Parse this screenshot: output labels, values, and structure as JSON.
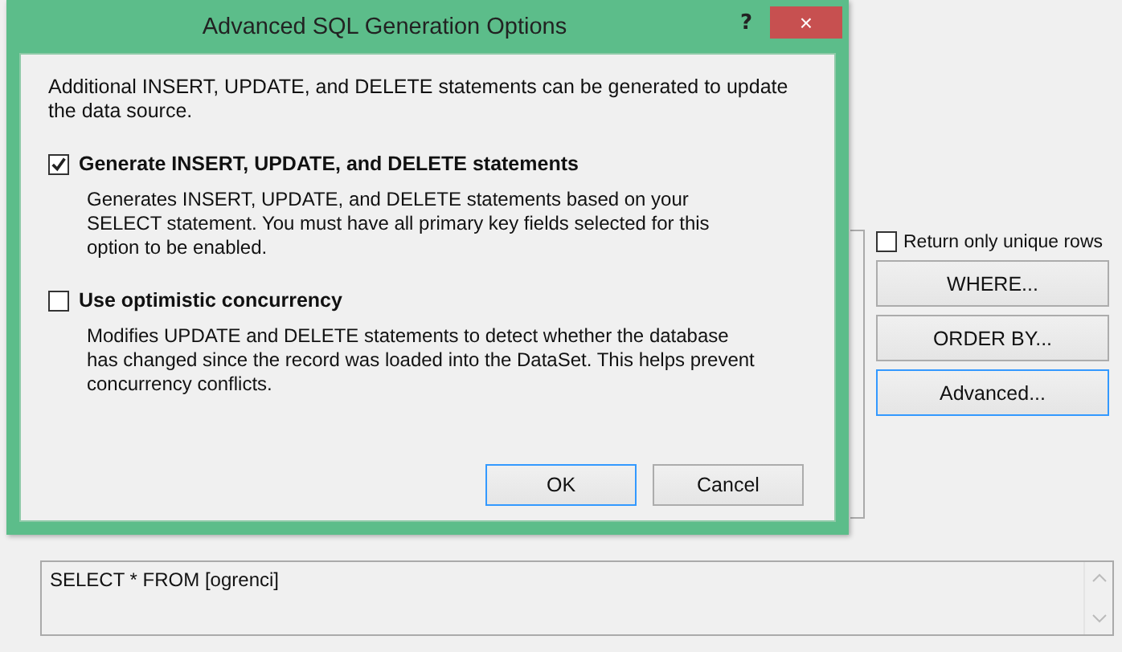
{
  "dialog": {
    "title": "Advanced SQL Generation Options",
    "help": "?",
    "close": "×",
    "intro": "Additional INSERT, UPDATE, and DELETE statements can be generated to update the data source.",
    "options": [
      {
        "label": "Generate INSERT, UPDATE, and DELETE statements",
        "checked": true,
        "description": "Generates INSERT, UPDATE, and DELETE statements based on your SELECT statement. You must have all primary key fields selected for this option to be enabled."
      },
      {
        "label": "Use optimistic concurrency",
        "checked": false,
        "description": "Modifies UPDATE and DELETE statements to detect whether the database has changed since the record was loaded into the DataSet. This helps prevent concurrency conflicts."
      }
    ],
    "buttons": [
      {
        "label": "OK",
        "default": true
      },
      {
        "label": "Cancel",
        "default": false
      }
    ]
  },
  "background": {
    "unique_rows": {
      "label": "Return only unique rows",
      "checked": false
    },
    "buttons": [
      {
        "label": "WHERE...",
        "focused": false
      },
      {
        "label": "ORDER BY...",
        "focused": false
      },
      {
        "label": "Advanced...",
        "focused": true
      }
    ],
    "select_statement": "SELECT * FROM [ogrenci]"
  }
}
